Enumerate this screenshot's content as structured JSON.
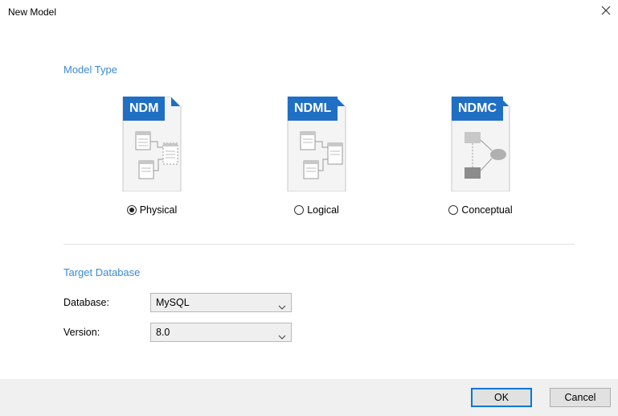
{
  "window": {
    "title": "New Model"
  },
  "model_type": {
    "heading": "Model Type",
    "options": [
      {
        "badge": "NDM",
        "label": "Physical",
        "checked": true
      },
      {
        "badge": "NDML",
        "label": "Logical",
        "checked": false
      },
      {
        "badge": "NDMC",
        "label": "Conceptual",
        "checked": false
      }
    ]
  },
  "target": {
    "heading": "Target Database",
    "database_label": "Database:",
    "database_value": "MySQL",
    "version_label": "Version:",
    "version_value": "8.0"
  },
  "buttons": {
    "ok": "OK",
    "cancel": "Cancel"
  },
  "colors": {
    "accent": "#3a8ad8",
    "badge": "#1f6fc4",
    "default_border": "#0078d7"
  }
}
